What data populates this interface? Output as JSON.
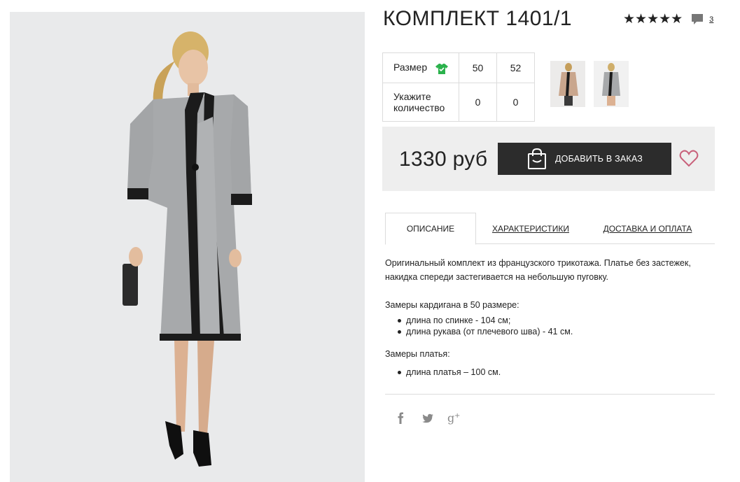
{
  "product": {
    "title": "КОМПЛЕКТ 1401/1",
    "stars": "★★★★★",
    "comment_count": "3"
  },
  "sizes": {
    "size_label": "Размер",
    "size_icon": "shirt-icon",
    "sizes": [
      "50",
      "52"
    ],
    "qty_label": "Укажите количество",
    "quantities": [
      "0",
      "0"
    ]
  },
  "price": {
    "amount": "1330 руб",
    "add_button": "ДОБАВИТЬ В ЗАКАЗ",
    "accent": "#c8607a"
  },
  "tabs": [
    "ОПИСАНИЕ",
    "ХАРАКТЕРИСТИКИ",
    "ДОСТАВКА И ОПЛАТА"
  ],
  "description": {
    "intro": "Оригинальный комплект из французского трикотажа. Платье без застежек, накидка спереди застегивается на небольшую пуговку.",
    "cardigan_heading": "Замеры кардигана в 50 размере:",
    "cardigan_items": [
      "длина по спинке - 104 см;",
      "длина рукава (от плечевого шва) - 41 см."
    ],
    "dress_heading": "Замеры платья:",
    "dress_items": [
      "длина платья – 100 см."
    ]
  },
  "social": [
    "facebook-icon",
    "twitter-icon",
    "google-plus-icon"
  ],
  "colors": {
    "button_bg": "#2c2c2c",
    "panel_bg": "#eeeeee",
    "shirt_icon": "#2bb24c",
    "heart": "#c8607a"
  }
}
